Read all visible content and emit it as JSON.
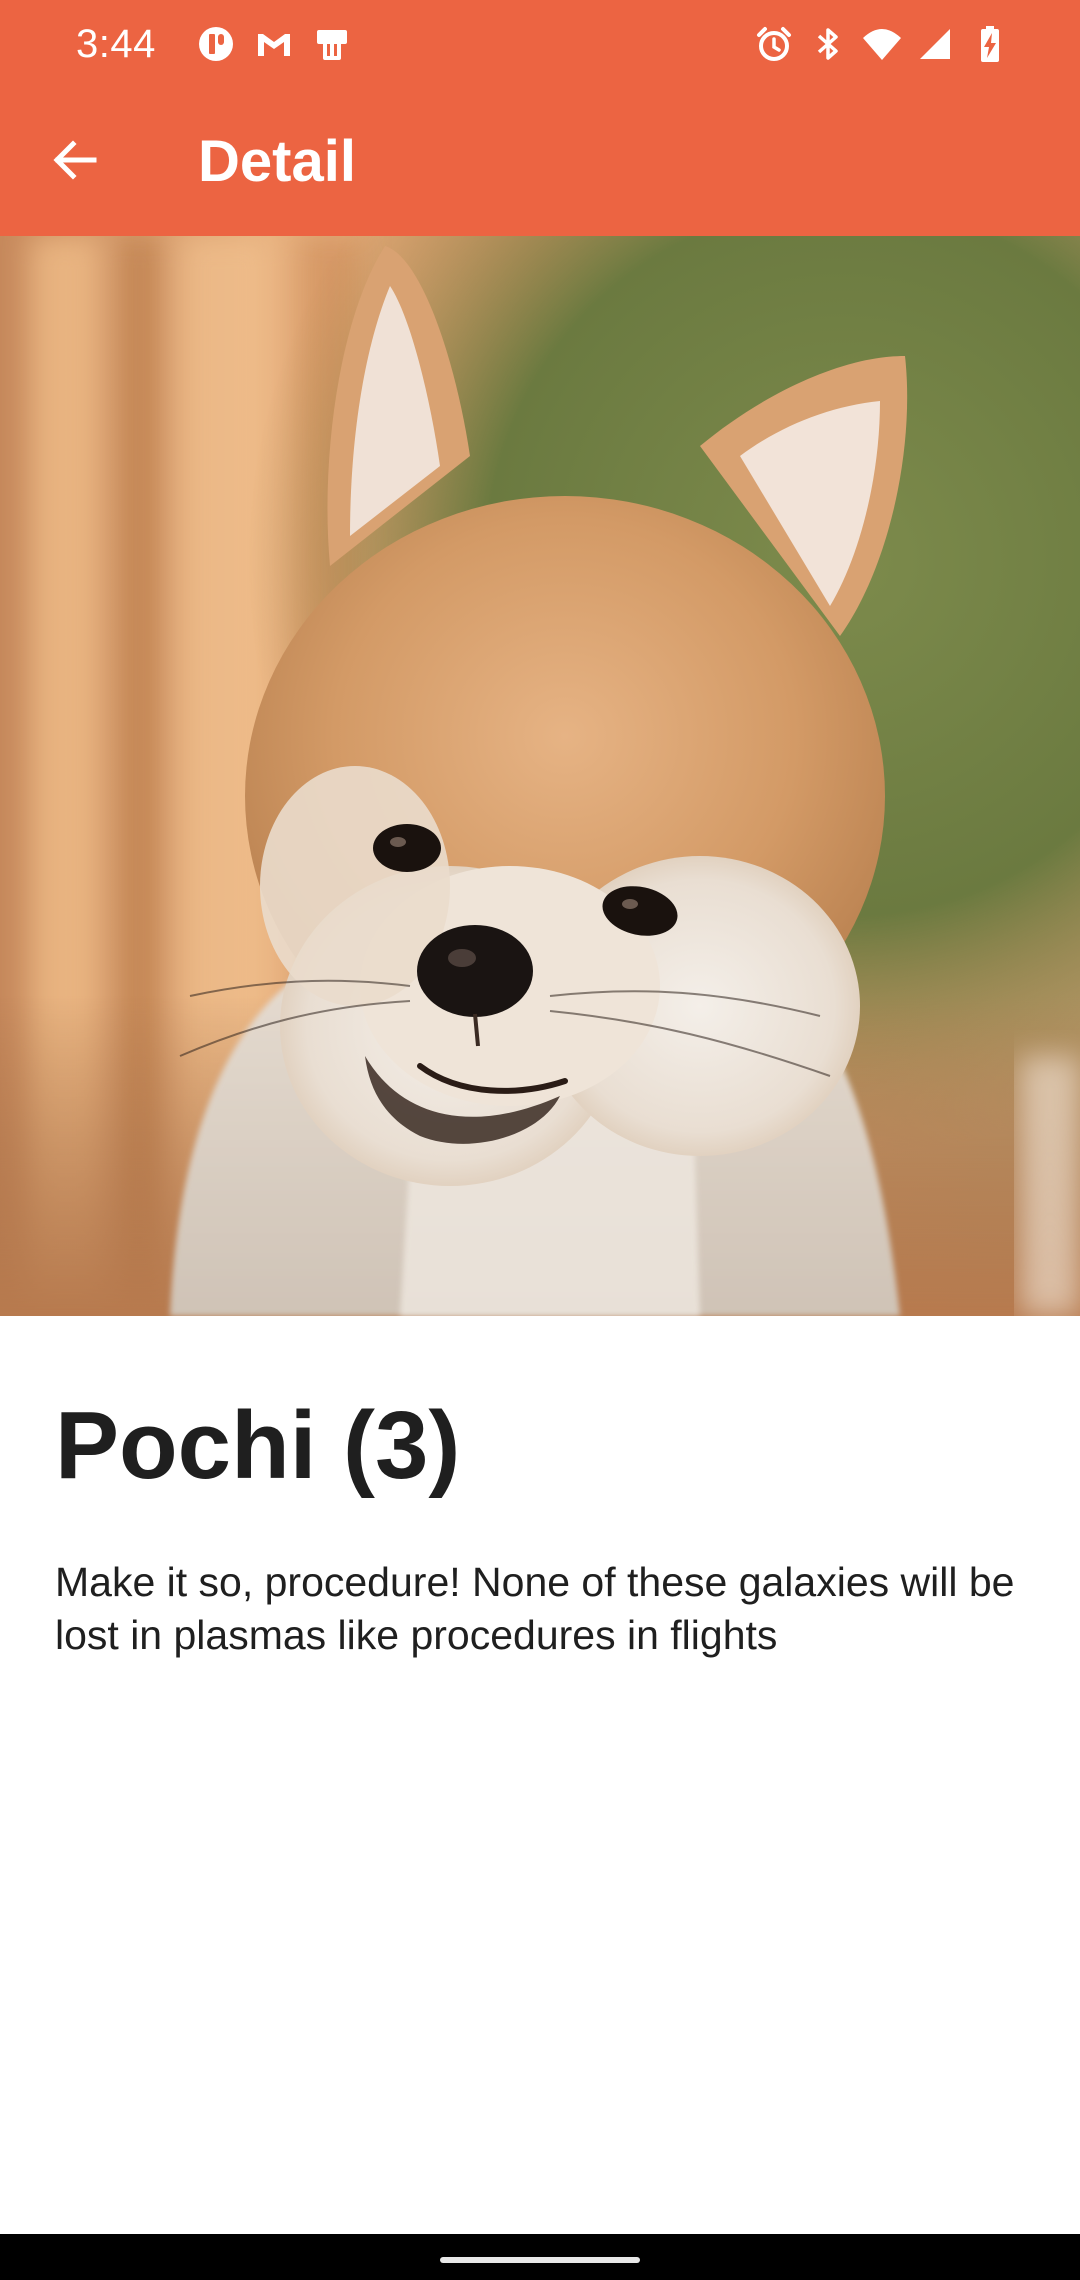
{
  "status_bar": {
    "time": "3:44",
    "left_icons": [
      "notification-app-icon",
      "gmail-icon",
      "pager-icon"
    ],
    "right_icons": [
      "alarm-icon",
      "bluetooth-icon",
      "wifi-icon",
      "signal-icon",
      "battery-charging-icon"
    ]
  },
  "app_bar": {
    "title": "Detail",
    "back_icon": "arrow-back-icon",
    "background_color": "#ec6442"
  },
  "pet": {
    "image": "shiba-inu-puppy-photo",
    "name": "Pochi (3)",
    "description": "Make it so, procedure! None of these galaxies will be lost in plasmas like procedures in flights"
  },
  "nav_bar": {
    "handle": "home-indicator"
  }
}
